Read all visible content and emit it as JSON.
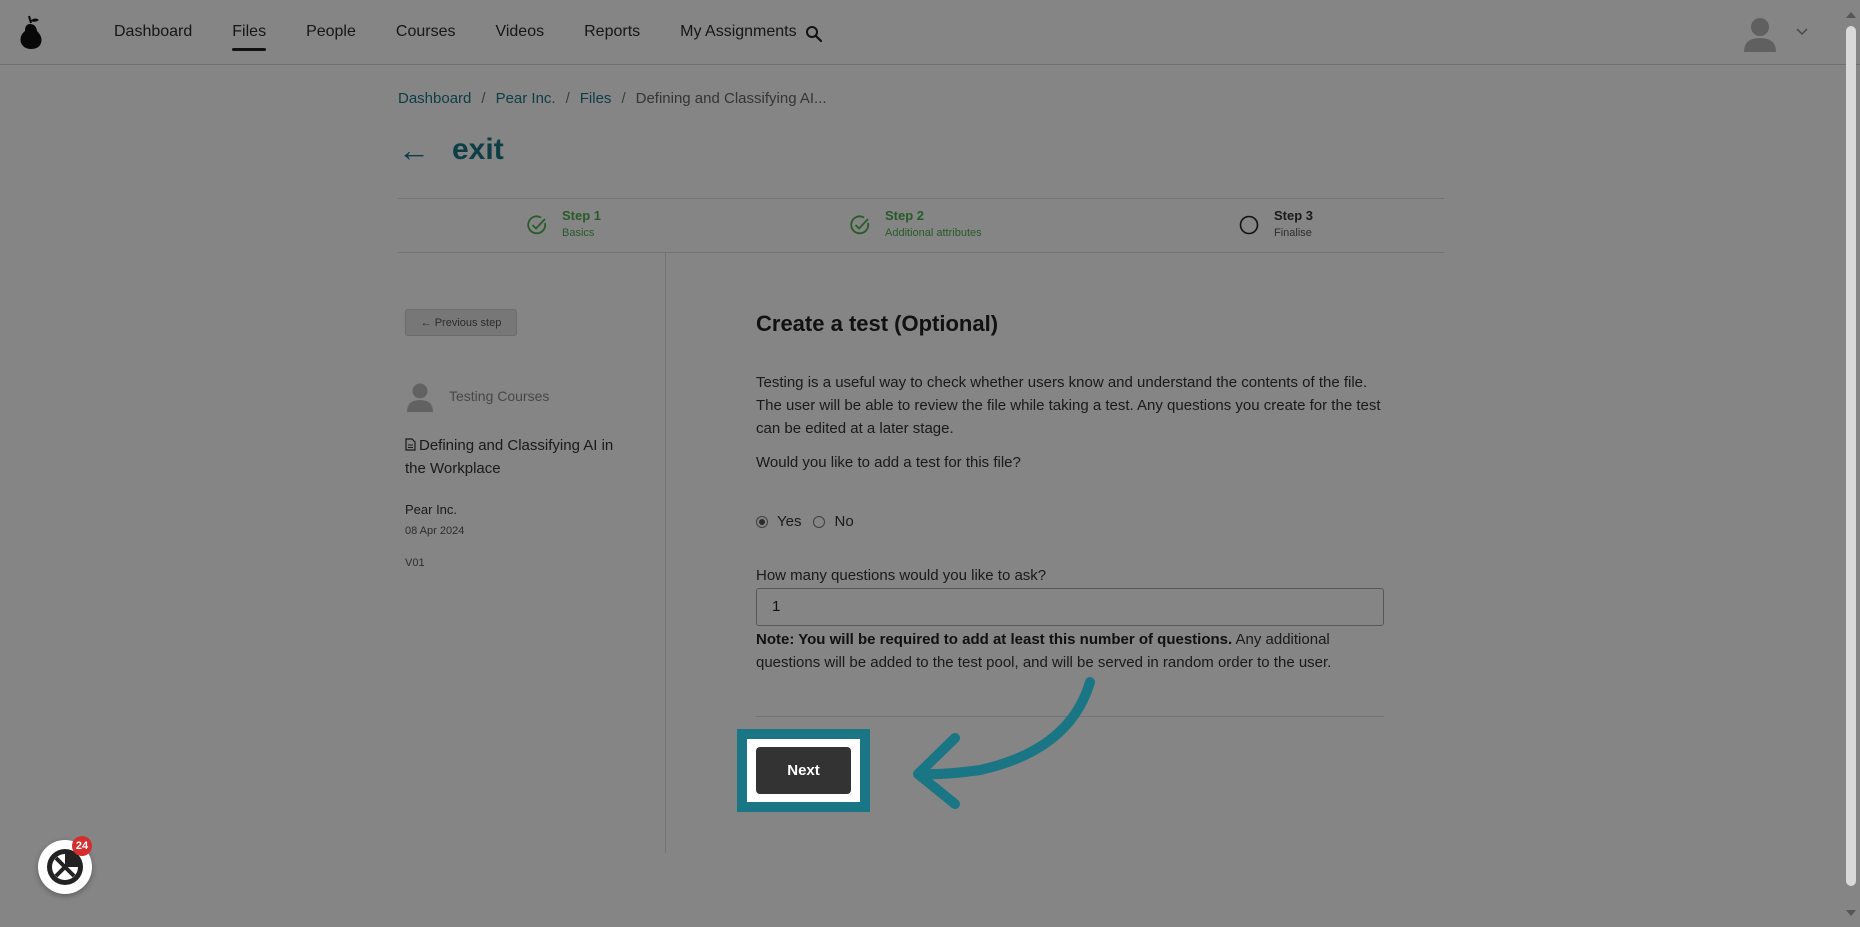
{
  "nav": {
    "items": [
      {
        "label": "Dashboard",
        "active": false
      },
      {
        "label": "Files",
        "active": true
      },
      {
        "label": "People",
        "active": false
      },
      {
        "label": "Courses",
        "active": false
      },
      {
        "label": "Videos",
        "active": false
      },
      {
        "label": "Reports",
        "active": false
      },
      {
        "label": "My Assignments",
        "active": false
      }
    ],
    "search_icon": "search-icon",
    "avatar_icon": "user-avatar-icon",
    "menu_icon": "chevron-down-icon"
  },
  "breadcrumb": {
    "items": [
      "Dashboard",
      "Pear Inc.",
      "Files"
    ],
    "separator": "/",
    "current": "Defining and Classifying AI..."
  },
  "exit": {
    "arrow": "←",
    "label": "exit"
  },
  "stepper": {
    "steps": [
      {
        "title": "Step 1",
        "subtitle": "Basics",
        "status": "complete"
      },
      {
        "title": "Step 2",
        "subtitle": "Additional attributes",
        "status": "complete"
      },
      {
        "title": "Step 3",
        "subtitle": "Finalise",
        "status": "pending"
      }
    ]
  },
  "sidebar": {
    "previous_step_label": "← Previous step",
    "author": "Testing Courses",
    "file_title": "Defining and Classifying AI in the Workplace",
    "company": "Pear Inc.",
    "date": "08 Apr 2024",
    "version": "V01"
  },
  "main": {
    "title": "Create a test (Optional)",
    "description": "Testing is a useful way to check whether users know and understand the contents of the file. The user will be able to review the file while taking a test. Any questions you create for the test can be edited at a later stage.",
    "question": "Would you like to add a test for this file?",
    "options": [
      {
        "label": "Yes",
        "checked": true
      },
      {
        "label": "No",
        "checked": false
      }
    ],
    "count_label": "How many questions would you like to ask?",
    "count_value": "1",
    "note_bold": "Note: You will be required to add at least this number of questions.",
    "note_rest": " Any additional questions will be added to the test pool, and will be served in random order to the user.",
    "next_label": "Next"
  },
  "chat": {
    "badge": "24"
  },
  "colors": {
    "accent": "#1a7585",
    "success": "#4caf50",
    "button_dark": "#333333",
    "badge": "#d32f2f"
  }
}
